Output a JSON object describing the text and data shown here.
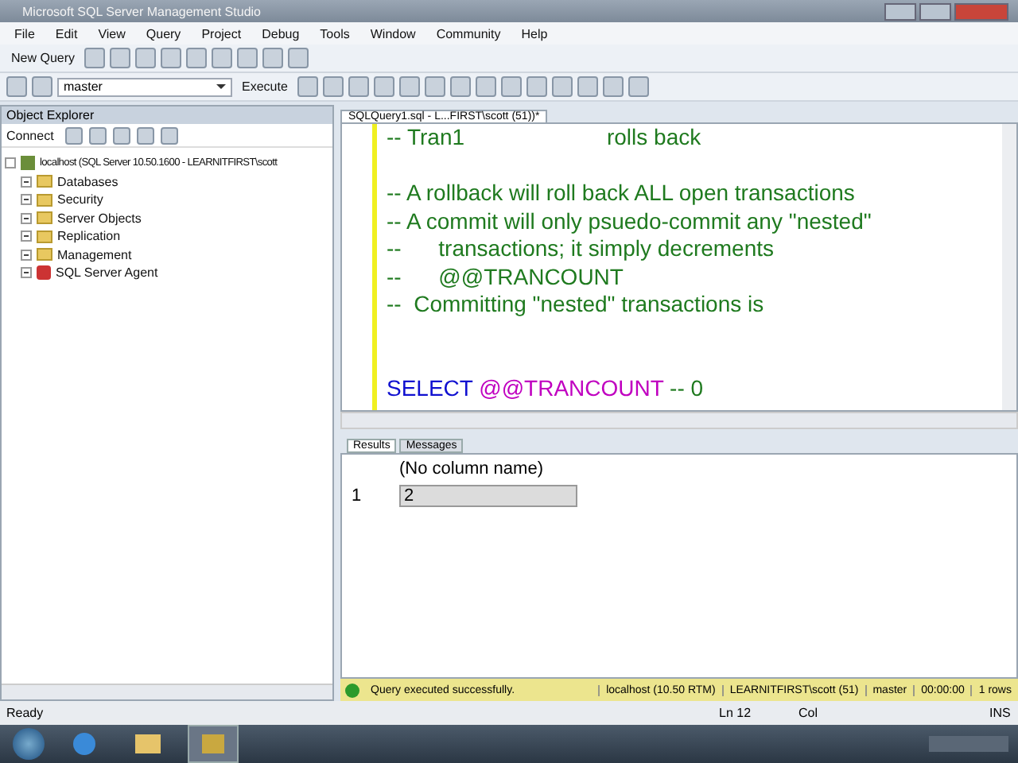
{
  "window": {
    "title": "Microsoft SQL Server Management Studio"
  },
  "menu": [
    "File",
    "Edit",
    "View",
    "Query",
    "Project",
    "Debug",
    "Tools",
    "Window",
    "Community",
    "Help"
  ],
  "toolbar": {
    "new_query": "New Query",
    "database": "master",
    "execute": "Execute"
  },
  "object_explorer": {
    "title": "Object Explorer",
    "connect": "Connect",
    "root": {
      "label": "localhost (SQL Server 10.50.1600 - LEARNITFIRST\\scott",
      "expanded": true,
      "children": [
        {
          "label": "Databases",
          "kind": "folder",
          "expanded": false
        },
        {
          "label": "Security",
          "kind": "folder",
          "expanded": false
        },
        {
          "label": "Server Objects",
          "kind": "folder",
          "expanded": false
        },
        {
          "label": "Replication",
          "kind": "folder",
          "expanded": false
        },
        {
          "label": "Management",
          "kind": "folder",
          "expanded": false
        },
        {
          "label": "SQL Server Agent",
          "kind": "agent",
          "expanded": false
        }
      ]
    }
  },
  "editor": {
    "tab": "SQLQuery1.sql - L...FIRST\\scott (51))*",
    "lines": [
      {
        "kind": "code",
        "segments": [
          {
            "kind": "comment",
            "text": "-- Tran1                       rolls back"
          }
        ]
      },
      {
        "kind": "blank"
      },
      {
        "kind": "code",
        "segments": [
          {
            "kind": "comment",
            "text": "-- A rollback will roll back ALL open transactions"
          }
        ]
      },
      {
        "kind": "code",
        "segments": [
          {
            "kind": "comment",
            "text": "-- A commit will only psuedo-commit any \"nested\""
          }
        ]
      },
      {
        "kind": "code",
        "segments": [
          {
            "kind": "comment",
            "text": "--      transactions; it simply decrements"
          }
        ]
      },
      {
        "kind": "code",
        "segments": [
          {
            "kind": "comment",
            "text": "--      @@TRANCOUNT"
          }
        ]
      },
      {
        "kind": "code",
        "segments": [
          {
            "kind": "comment",
            "text": "--  Committing \"nested\" transactions is"
          }
        ]
      },
      {
        "kind": "blank"
      },
      {
        "kind": "blank"
      },
      {
        "kind": "code",
        "segments": [
          {
            "kind": "keyword",
            "text": "SELECT"
          },
          {
            "kind": "variable",
            "text": " @@TRANCOUNT"
          },
          {
            "kind": "comment",
            "text": " -- 0"
          }
        ]
      }
    ]
  },
  "results": {
    "tabs": [
      {
        "label": "Results",
        "selected": true
      },
      {
        "label": "Messages",
        "selected": false
      }
    ],
    "columns": [
      "(No column name)"
    ],
    "rows": [
      {
        "number": "1",
        "cells": [
          "2"
        ],
        "selected": true
      }
    ]
  },
  "query_status": {
    "message": "Query executed successfully.",
    "server": "localhost (10.50 RTM)",
    "login": "LEARNITFIRST\\scott (51)",
    "database": "master",
    "time": "00:00:00",
    "rows": "1 rows"
  },
  "status_bar": {
    "state": "Ready",
    "line": "Ln 12",
    "column": "Col",
    "mode": "INS"
  }
}
